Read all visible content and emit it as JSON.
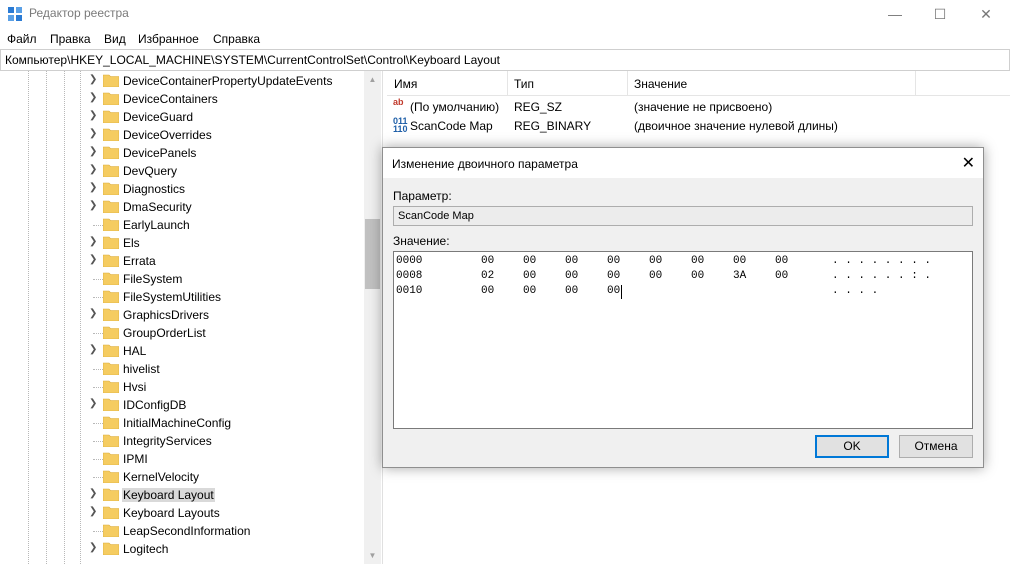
{
  "window": {
    "title": "Редактор реестра",
    "minimize": "—",
    "maximize": "☐",
    "close": "✕"
  },
  "menu": [
    "Файл",
    "Правка",
    "Вид",
    "Избранное",
    "Справка"
  ],
  "address": "Компьютер\\HKEY_LOCAL_MACHINE\\SYSTEM\\CurrentControlSet\\Control\\Keyboard Layout",
  "tree": {
    "items": [
      {
        "label": "DeviceContainerPropertyUpdateEvents",
        "expandable": true
      },
      {
        "label": "DeviceContainers",
        "expandable": true
      },
      {
        "label": "DeviceGuard",
        "expandable": true
      },
      {
        "label": "DeviceOverrides",
        "expandable": true
      },
      {
        "label": "DevicePanels",
        "expandable": true
      },
      {
        "label": "DevQuery",
        "expandable": true
      },
      {
        "label": "Diagnostics",
        "expandable": true
      },
      {
        "label": "DmaSecurity",
        "expandable": true
      },
      {
        "label": "EarlyLaunch",
        "expandable": false
      },
      {
        "label": "Els",
        "expandable": true
      },
      {
        "label": "Errata",
        "expandable": true
      },
      {
        "label": "FileSystem",
        "expandable": false
      },
      {
        "label": "FileSystemUtilities",
        "expandable": false
      },
      {
        "label": "GraphicsDrivers",
        "expandable": true
      },
      {
        "label": "GroupOrderList",
        "expandable": false
      },
      {
        "label": "HAL",
        "expandable": true
      },
      {
        "label": "hivelist",
        "expandable": false
      },
      {
        "label": "Hvsi",
        "expandable": false
      },
      {
        "label": "IDConfigDB",
        "expandable": true
      },
      {
        "label": "InitialMachineConfig",
        "expandable": false
      },
      {
        "label": "IntegrityServices",
        "expandable": false
      },
      {
        "label": "IPMI",
        "expandable": false
      },
      {
        "label": "KernelVelocity",
        "expandable": false
      },
      {
        "label": "Keyboard Layout",
        "expandable": true,
        "selected": true
      },
      {
        "label": "Keyboard Layouts",
        "expandable": true
      },
      {
        "label": "LeapSecondInformation",
        "expandable": false
      },
      {
        "label": "Logitech",
        "expandable": true
      }
    ]
  },
  "list": {
    "columns": [
      "Имя",
      "Тип",
      "Значение"
    ],
    "rows": [
      {
        "icon": "string-value-icon",
        "name": "(По умолчанию)",
        "type": "REG_SZ",
        "value": "(значение не присвоено)"
      },
      {
        "icon": "binary-value-icon",
        "name": "ScanCode Map",
        "type": "REG_BINARY",
        "value": "(двоичное значение нулевой длины)"
      }
    ]
  },
  "dialog": {
    "title": "Изменение двоичного параметра",
    "param_label": "Параметр:",
    "param_value": "ScanCode Map",
    "value_label": "Значение:",
    "hex_lines": [
      {
        "offset": "0000",
        "bytes": [
          "00",
          "00",
          "00",
          "00",
          "00",
          "00",
          "00",
          "00"
        ],
        "ascii": ". . . . . . . ."
      },
      {
        "offset": "0008",
        "bytes": [
          "02",
          "00",
          "00",
          "00",
          "00",
          "00",
          "3A",
          "00"
        ],
        "ascii": ". . . . . . : ."
      },
      {
        "offset": "0010",
        "bytes": [
          "00",
          "00",
          "00",
          "00"
        ],
        "ascii": ". . . ."
      }
    ],
    "ok_label": "OK",
    "cancel_label": "Отмена"
  },
  "colors": {
    "selection": "#d9d9d9",
    "folder": "#f5cc61",
    "accent": "#0078d7"
  }
}
